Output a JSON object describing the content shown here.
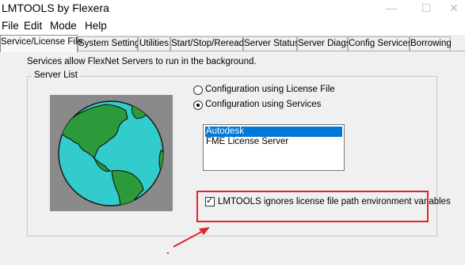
{
  "window": {
    "title": "LMTOOLS by Flexera",
    "minimize_glyph": "—",
    "maximize_glyph": "☐",
    "close_glyph": "✕"
  },
  "menu": [
    "File",
    "Edit",
    "Mode",
    "Help"
  ],
  "tabs": [
    {
      "label": "Service/License File",
      "active": true
    },
    {
      "label": "System Settings",
      "active": false
    },
    {
      "label": "Utilities",
      "active": false
    },
    {
      "label": "Start/Stop/Reread",
      "active": false
    },
    {
      "label": "Server Status",
      "active": false
    },
    {
      "label": "Server Diags",
      "active": false
    },
    {
      "label": "Config Services",
      "active": false
    },
    {
      "label": "Borrowing",
      "active": false
    }
  ],
  "panel": {
    "intro_text": "Services allow FlexNet Servers to run in the background.",
    "group_title": "Server List",
    "radio_license_file": {
      "label": "Configuration using License File",
      "checked": false
    },
    "radio_services": {
      "label": "Configuration using Services",
      "checked": true
    },
    "services_list": [
      {
        "label": "Autodesk",
        "selected": true
      },
      {
        "label": "FME License Server",
        "selected": false
      }
    ],
    "ignore_env_checkbox": {
      "label": "LMTOOLS ignores license file path environment variables",
      "checked": true,
      "check_glyph": "✓"
    }
  },
  "colors": {
    "selection": "#0078d7",
    "annotation": "#e2252b",
    "globe_background": "#8a8a8a",
    "ocean": "#33cccc",
    "land": "#2b9a3a"
  },
  "icons": {
    "globe": "globe-icon",
    "arrow": "annotation-arrow"
  }
}
